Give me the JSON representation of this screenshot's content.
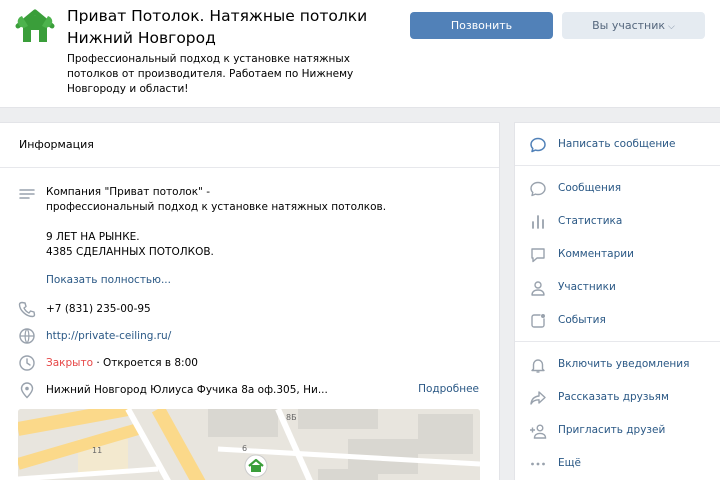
{
  "header": {
    "title": "Приват Потолок. Натяжные потолки Нижний Новгород",
    "description": "Профессиональный подход к установке натяжных потолков от производителя. Работаем по Нижнему Новгороду и области!",
    "call_button": "Позвонить",
    "member_button": "Вы участник",
    "logo_icon": "house-leaf-logo"
  },
  "info": {
    "heading": "Информация",
    "about": "Компания \"Приват потолок\" -\nпрофессиональный подход к установке натяжных потолков.\n\n9 ЛЕТ НА РЫНКЕ.\n4385 СДЕЛАННЫХ ПОТОЛКОВ.",
    "show_more": "Показать полностью...",
    "phone": "+7 (831) 235-00-95",
    "website": "http://private-ceiling.ru/",
    "status_closed": "Закрыто",
    "status_opens": " · Откроется в 8:00",
    "address": "Нижний Новгород Юлиуса Фучика 8а оф.305, Ни...",
    "address_more": "Подробнее",
    "map_labels": [
      "8Б",
      "11",
      "6"
    ]
  },
  "sidebar": {
    "primary": {
      "label": "Написать сообщение",
      "icon": "message-bubble-icon"
    },
    "items": [
      {
        "label": "Сообщения",
        "icon": "chat-bubble-icon"
      },
      {
        "label": "Статистика",
        "icon": "bar-chart-icon"
      },
      {
        "label": "Комментарии",
        "icon": "comment-icon"
      },
      {
        "label": "Участники",
        "icon": "user-icon"
      },
      {
        "label": "События",
        "icon": "event-icon"
      }
    ],
    "actions": [
      {
        "label": "Включить уведомления",
        "icon": "bell-icon"
      },
      {
        "label": "Рассказать друзьям",
        "icon": "share-arrow-icon"
      },
      {
        "label": "Пригласить друзей",
        "icon": "add-user-icon"
      },
      {
        "label": "Ещё",
        "icon": "more-dots-icon"
      }
    ]
  },
  "colors": {
    "accent": "#5181b8",
    "link": "#2a5885",
    "closed": "#e64646",
    "logo_green": "#3a9e3a"
  }
}
